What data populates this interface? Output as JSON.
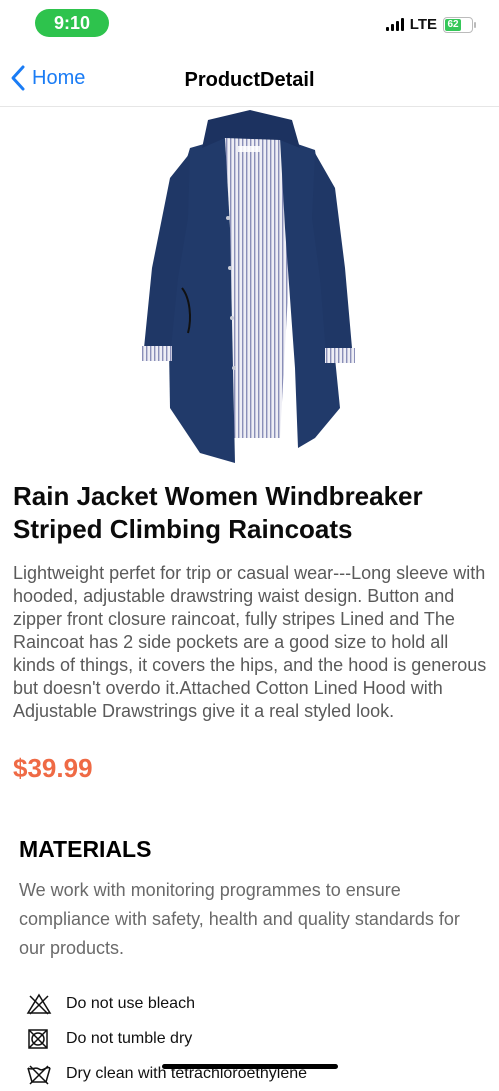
{
  "status_bar": {
    "time": "9:10",
    "network": "LTE",
    "battery": "62"
  },
  "nav": {
    "back_label": "Home",
    "title": "ProductDetail"
  },
  "product": {
    "title": "Rain Jacket Women Windbreaker Striped Climbing Raincoats",
    "description": "Lightweight perfet for trip or casual wear---Long sleeve with hooded, adjustable drawstring waist design. Button and zipper front closure raincoat, fully stripes Lined and The Raincoat has 2 side pockets are a good size to hold all kinds of things, it covers the hips, and the hood is generous but doesn't overdo it.Attached Cotton Lined Hood with Adjustable Drawstrings give it a real styled look.",
    "price": "$39.99",
    "image_icon": "navy-raincoat-image"
  },
  "materials": {
    "heading": "MATERIALS",
    "text": "We work with monitoring programmes to ensure compliance with safety, health and quality standards for our products.",
    "care": [
      {
        "icon": "no-bleach-icon",
        "label": "Do not use bleach"
      },
      {
        "icon": "no-tumble-dry-icon",
        "label": "Do not tumble dry"
      },
      {
        "icon": "dry-clean-icon",
        "label": "Dry clean with tetrachloroethylene"
      }
    ]
  },
  "colors": {
    "accent": "#1a7cf5",
    "price": "#ef6a45",
    "time_pill": "#2ec34d",
    "jacket": "#213a6a"
  }
}
